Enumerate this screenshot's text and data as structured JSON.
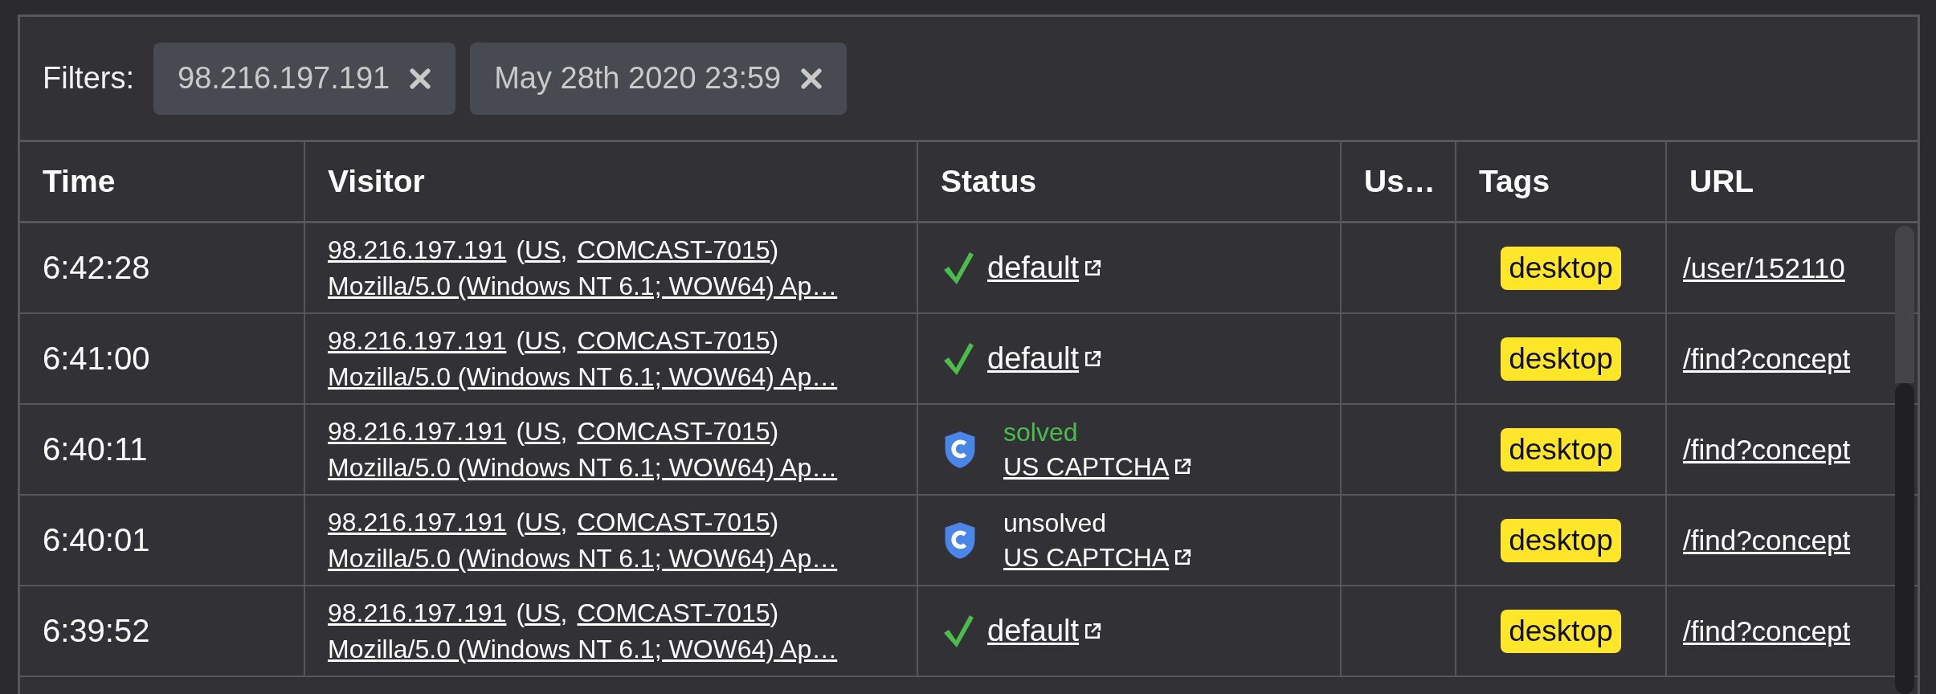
{
  "filters": {
    "label": "Filters:",
    "chips": [
      {
        "text": "98.216.197.191"
      },
      {
        "text": "May 28th 2020 23:59"
      }
    ]
  },
  "table": {
    "columns": [
      "Time",
      "Visitor",
      "Status",
      "Us…",
      "Tags",
      "URL"
    ],
    "rows": [
      {
        "time": "6:42:28",
        "visitor": {
          "ip": "98.216.197.191",
          "open": "(",
          "country": "US",
          "sep": ",",
          "isp": "COMCAST-7015",
          "close": ")",
          "agent": "Mozilla/5.0 (Windows NT 6.1; WOW64) Ap…"
        },
        "status": {
          "kind": "default",
          "label": "default"
        },
        "tags": [
          "desktop"
        ],
        "url": "/user/152110"
      },
      {
        "time": "6:41:00",
        "visitor": {
          "ip": "98.216.197.191",
          "open": "(",
          "country": "US",
          "sep": ",",
          "isp": "COMCAST-7015",
          "close": ")",
          "agent": "Mozilla/5.0 (Windows NT 6.1; WOW64) Ap…"
        },
        "status": {
          "kind": "default",
          "label": "default"
        },
        "tags": [
          "desktop"
        ],
        "url": "/find?concept"
      },
      {
        "time": "6:40:11",
        "visitor": {
          "ip": "98.216.197.191",
          "open": "(",
          "country": "US",
          "sep": ",",
          "isp": "COMCAST-7015",
          "close": ")",
          "agent": "Mozilla/5.0 (Windows NT 6.1; WOW64) Ap…"
        },
        "status": {
          "kind": "captcha",
          "result": "solved",
          "solved": true,
          "label": "US CAPTCHA"
        },
        "tags": [
          "desktop"
        ],
        "url": "/find?concept"
      },
      {
        "time": "6:40:01",
        "visitor": {
          "ip": "98.216.197.191",
          "open": "(",
          "country": "US",
          "sep": ",",
          "isp": "COMCAST-7015",
          "close": ")",
          "agent": "Mozilla/5.0 (Windows NT 6.1; WOW64) Ap…"
        },
        "status": {
          "kind": "captcha",
          "result": "unsolved",
          "solved": false,
          "label": "US CAPTCHA"
        },
        "tags": [
          "desktop"
        ],
        "url": "/find?concept"
      },
      {
        "time": "6:39:52",
        "visitor": {
          "ip": "98.216.197.191",
          "open": "(",
          "country": "US",
          "sep": ",",
          "isp": "COMCAST-7015",
          "close": ")",
          "agent": "Mozilla/5.0 (Windows NT 6.1; WOW64) Ap…"
        },
        "status": {
          "kind": "default",
          "label": "default"
        },
        "tags": [
          "desktop"
        ],
        "url": "/find?concept"
      }
    ]
  }
}
